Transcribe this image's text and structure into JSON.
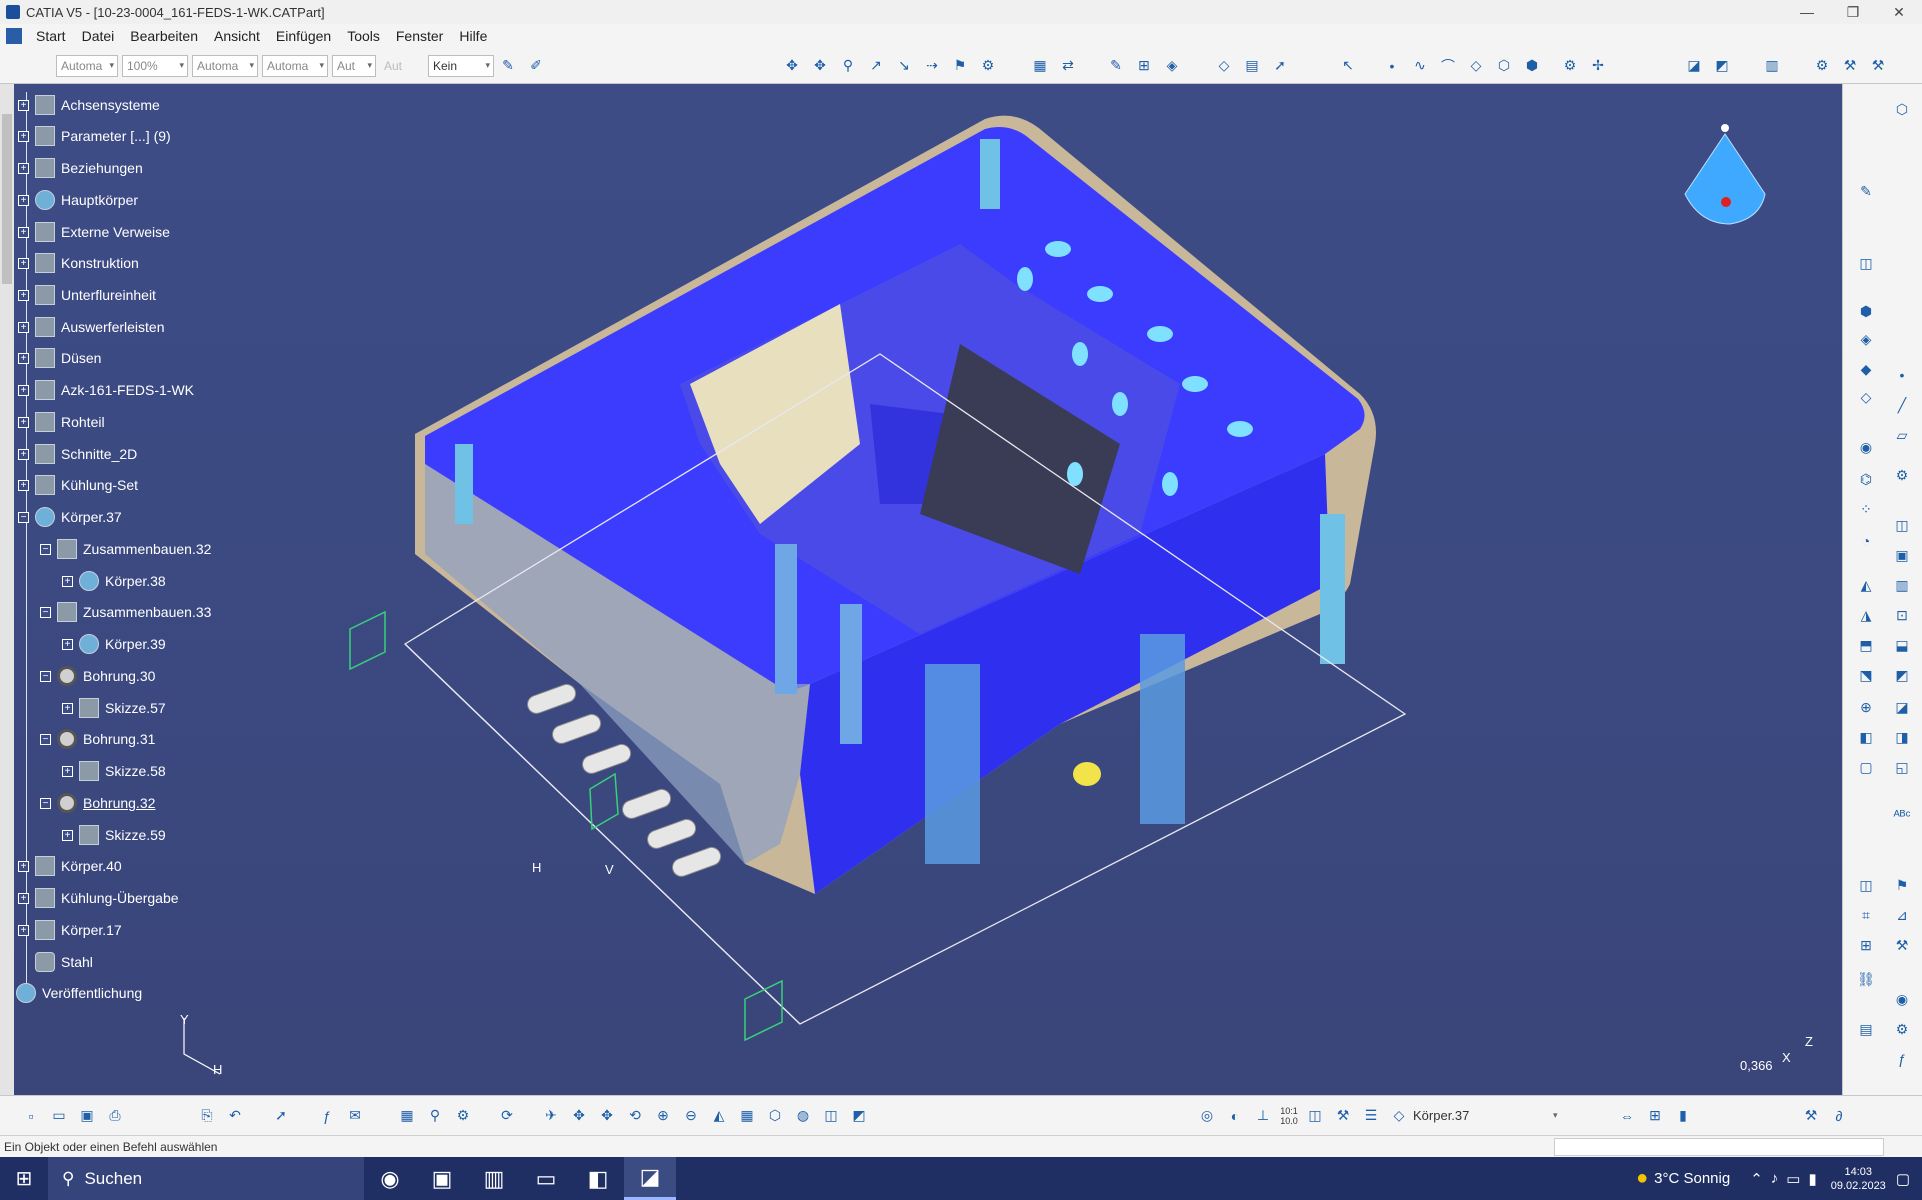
{
  "window": {
    "title": "CATIA V5 - [10-23-0004_161-FEDS-1-WK.CATPart]",
    "min": "—",
    "max": "❐",
    "close": "✕"
  },
  "menu": {
    "items": [
      "Start",
      "Datei",
      "Bearbeiten",
      "Ansicht",
      "Einfügen",
      "Tools",
      "Fenster",
      "Hilfe"
    ]
  },
  "toolbar": {
    "combos": [
      "Automa",
      "100%",
      "Automa",
      "Automa",
      "Aut",
      "Aut",
      "Kein"
    ]
  },
  "tree": {
    "nodes": [
      {
        "label": "Achsensysteme"
      },
      {
        "label": "Parameter [...] (9)"
      },
      {
        "label": "Beziehungen"
      },
      {
        "label": "Hauptkörper"
      },
      {
        "label": "Externe Verweise"
      },
      {
        "label": "Konstruktion"
      },
      {
        "label": "Unterflureinheit"
      },
      {
        "label": "Auswerferleisten"
      },
      {
        "label": "Düsen"
      },
      {
        "label": "Azk-161-FEDS-1-WK"
      },
      {
        "label": "Rohteil"
      },
      {
        "label": "Schnitte_2D"
      },
      {
        "label": "Kühlung-Set"
      },
      {
        "label": "Körper.37"
      },
      {
        "label": "Zusammenbauen.32"
      },
      {
        "label": "Körper.38"
      },
      {
        "label": "Zusammenbauen.33"
      },
      {
        "label": "Körper.39"
      },
      {
        "label": "Bohrung.30"
      },
      {
        "label": "Skizze.57"
      },
      {
        "label": "Bohrung.31"
      },
      {
        "label": "Skizze.58"
      },
      {
        "label": "Bohrung.32"
      },
      {
        "label": "Skizze.59"
      },
      {
        "label": "Körper.40"
      },
      {
        "label": "Kühlung-Übergabe"
      },
      {
        "label": "Körper.17"
      },
      {
        "label": "Stahl"
      },
      {
        "label": "Veröffentlichung"
      }
    ]
  },
  "viewport": {
    "scale": "0,366",
    "axis_y": "Y",
    "axis_h": "H",
    "axis_v": "V",
    "axis_x": "X",
    "axis_z": "Z"
  },
  "bottom": {
    "current_body": "Körper.37",
    "ratio_top": "10:1",
    "ratio_bottom": "10.0"
  },
  "status": {
    "message": "Ein Objekt oder einen Befehl auswählen"
  },
  "taskbar": {
    "search": "Suchen",
    "weather": "3°C  Sonnig",
    "time": "14:03",
    "date": "09.02.2023"
  }
}
